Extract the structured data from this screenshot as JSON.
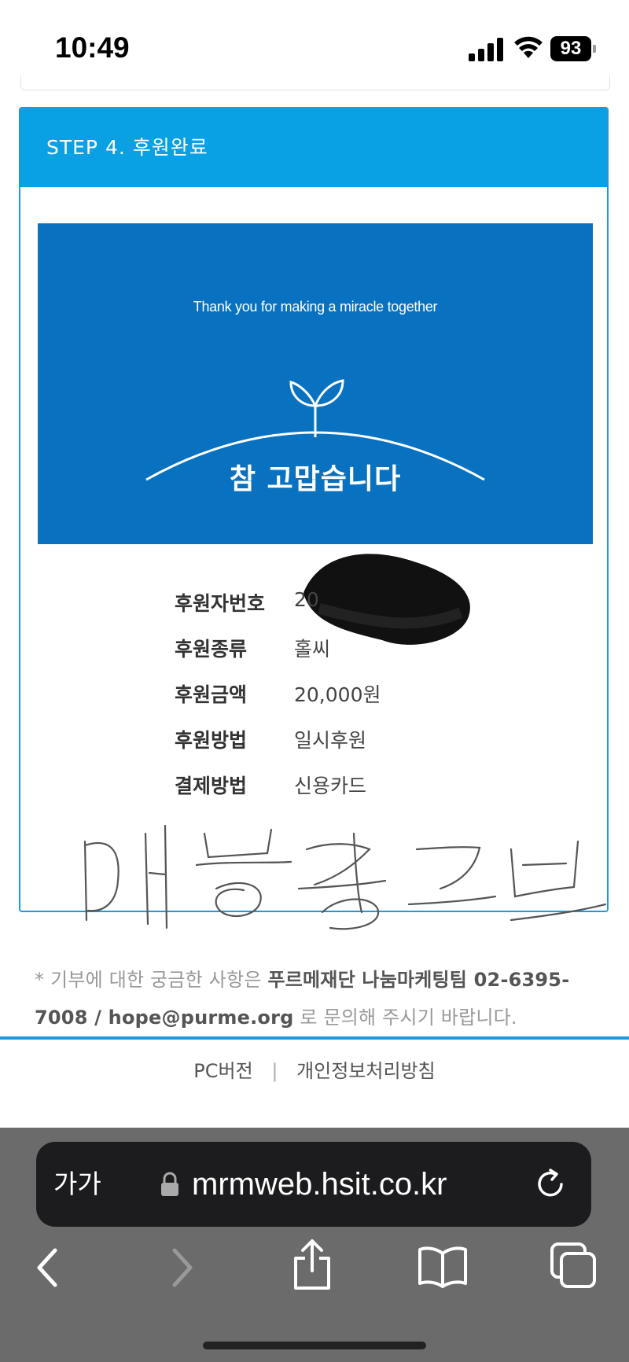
{
  "status_bar": {
    "time": "10:49",
    "battery": "93"
  },
  "step": {
    "title": "STEP 4. 후원완료"
  },
  "banner": {
    "subtitle": "Thank you for making a miracle together",
    "title": "참 고맙습니다"
  },
  "info": [
    {
      "label": "후원자번호",
      "value": "20"
    },
    {
      "label": "후원종류",
      "value": "홀씨"
    },
    {
      "label": "후원금액",
      "value": "20,000원"
    },
    {
      "label": "후원방법",
      "value": "일시후원"
    },
    {
      "label": "결제방법",
      "value": "신용카드"
    }
  ],
  "notice": {
    "prefix": "* 기부에 대한 궁금한 사항은",
    "contact": "푸르메재단 나눔마케팅팀 02-6395-7008 / hope@purme.org",
    "suffix": "로 문의해 주시기 바랍니다."
  },
  "footer": {
    "pc_version": "PC버전",
    "separator": "|",
    "privacy": "개인정보처리방침"
  },
  "safari": {
    "text_size": "가가",
    "url": "mrmweb.hsit.co.kr"
  },
  "colors": {
    "header_blue": "#0aa0e4",
    "banner_blue": "#0872c0",
    "toolbar": "#6b6b6b"
  }
}
